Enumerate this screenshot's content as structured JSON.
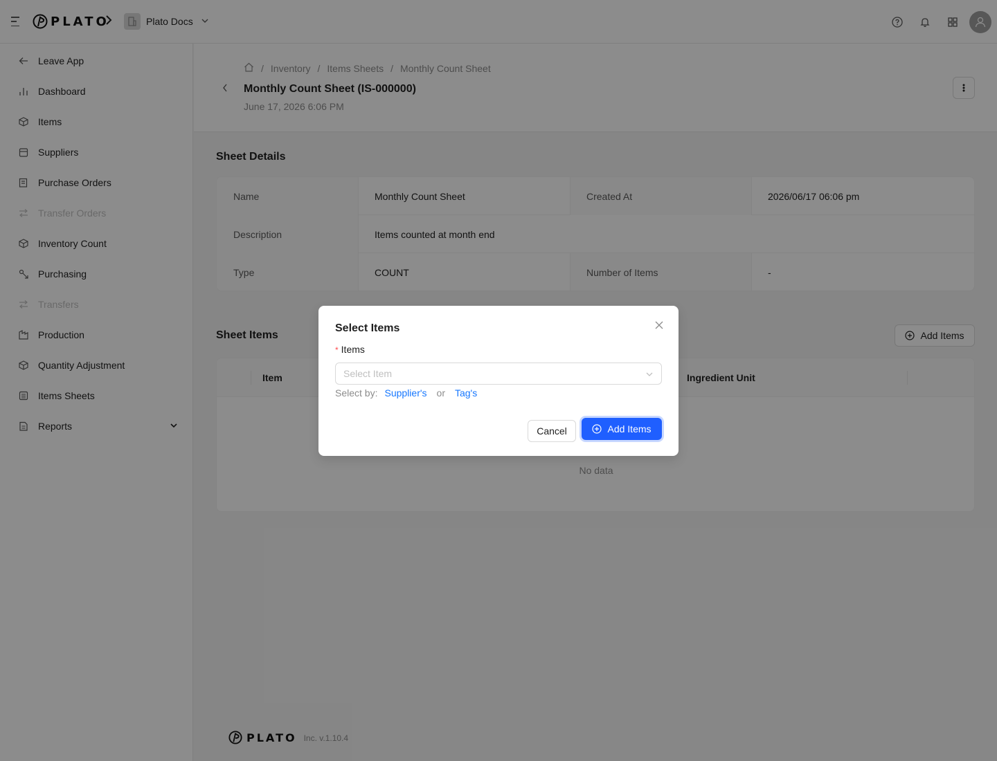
{
  "topbar": {
    "logo_text": "PLATO",
    "org_name": "Plato Docs"
  },
  "sidebar": {
    "items": [
      {
        "label": "Leave App",
        "icon": "arrow-left-icon",
        "disabled": false
      },
      {
        "label": "Dashboard",
        "icon": "bar-chart-icon",
        "disabled": false
      },
      {
        "label": "Items",
        "icon": "box-icon",
        "disabled": false
      },
      {
        "label": "Suppliers",
        "icon": "store-icon",
        "disabled": false
      },
      {
        "label": "Purchase Orders",
        "icon": "order-icon",
        "disabled": false
      },
      {
        "label": "Transfer Orders",
        "icon": "transfer-icon",
        "disabled": true
      },
      {
        "label": "Inventory Count",
        "icon": "box-count-icon",
        "disabled": false
      },
      {
        "label": "Purchasing",
        "icon": "purchasing-icon",
        "disabled": false
      },
      {
        "label": "Transfers",
        "icon": "transfer-icon",
        "disabled": true
      },
      {
        "label": "Production",
        "icon": "factory-icon",
        "disabled": false
      },
      {
        "label": "Quantity Adjustment",
        "icon": "box-adjust-icon",
        "disabled": false
      },
      {
        "label": "Items Sheets",
        "icon": "list-icon",
        "disabled": false
      },
      {
        "label": "Reports",
        "icon": "report-icon",
        "disabled": false
      }
    ]
  },
  "header": {
    "breadcrumb": [
      "Inventory",
      "Items Sheets",
      "Monthly Count Sheet"
    ],
    "title": "Monthly Count Sheet (IS-000000)",
    "subtitle": "June 17, 2026 6:06 PM"
  },
  "sheet_details": {
    "title": "Sheet Details",
    "rows": [
      {
        "label1": "Name",
        "value1": "Monthly Count Sheet",
        "label2": "Created At",
        "value2": "2026/06/17 06:06 pm"
      },
      {
        "label1": "Description",
        "value1": "Items counted at month end"
      },
      {
        "label1": "Type",
        "value1": "COUNT",
        "label2": "Number of Items",
        "value2": "-"
      }
    ]
  },
  "sheet_items": {
    "title": "Sheet Items",
    "add_label": "Add Items",
    "columns": [
      "Item",
      "Ingredient Unit"
    ],
    "empty_text": "No data"
  },
  "footer": {
    "logo_text": "PLATO",
    "version": "Inc. v.1.10.4"
  },
  "modal": {
    "title": "Select Items",
    "field_label": "Items",
    "required_mark": "*",
    "select_placeholder": "Select Item",
    "select_by_label": "Select by:",
    "supplier_link": "Supplier's",
    "or_text": "or",
    "tag_link": "Tag's",
    "cancel_label": "Cancel",
    "add_label": "Add Items"
  },
  "colors": {
    "primary": "#1f5fff",
    "link": "#1677ff",
    "required": "#ff4d4f"
  }
}
